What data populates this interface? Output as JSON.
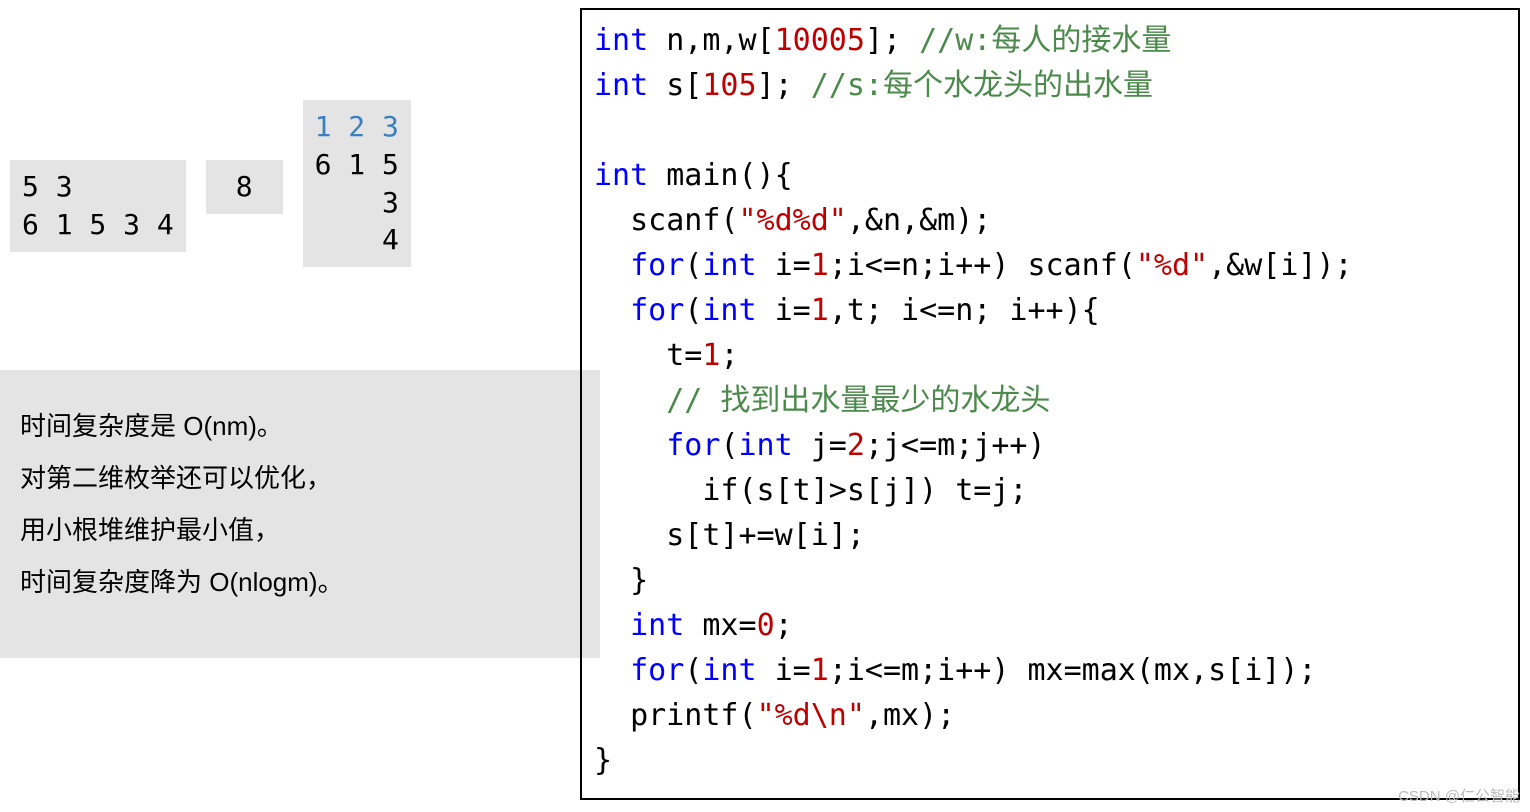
{
  "data_boxes": {
    "box1": {
      "line1": "5 3",
      "line2": "6 1 5 3 4"
    },
    "box2": {
      "value": "8"
    },
    "box3": {
      "header": "1 2 3",
      "rows": [
        "6 1 5",
        "    3",
        "    4"
      ]
    }
  },
  "notes": {
    "line1": "时间复杂度是 O(nm)。",
    "line2": "对第二维枚举还可以优化，",
    "line3": "用小根堆维护最小值，",
    "line4": "时间复杂度降为 O(nlogm)。"
  },
  "code": {
    "l1_a": "int",
    "l1_b": " n,m,w[",
    "l1_c": "10005",
    "l1_d": "]; ",
    "l1_e": "//w:每人的接水量",
    "l2_a": "int",
    "l2_b": " s[",
    "l2_c": "105",
    "l2_d": "]; ",
    "l2_e": "//s:每个水龙头的出水量",
    "l3": "",
    "l4_a": "int",
    "l4_b": " main(){",
    "l5_a": "  scanf(",
    "l5_b": "\"%d%d\"",
    "l5_c": ",&n,&m);",
    "l6_a": "  ",
    "l6_b": "for",
    "l6_c": "(",
    "l6_d": "int",
    "l6_e": " i=",
    "l6_f": "1",
    "l6_g": ";i<=n;i++) scanf(",
    "l6_h": "\"%d\"",
    "l6_i": ",&w[i]);",
    "l7_a": "  ",
    "l7_b": "for",
    "l7_c": "(",
    "l7_d": "int",
    "l7_e": " i=",
    "l7_f": "1",
    "l7_g": ",t; i<=n; i++){",
    "l8_a": "    t=",
    "l8_b": "1",
    "l8_c": ";",
    "l9_a": "    ",
    "l9_b": "// 找到出水量最少的水龙头",
    "l10_a": "    ",
    "l10_b": "for",
    "l10_c": "(",
    "l10_d": "int",
    "l10_e": " j=",
    "l10_f": "2",
    "l10_g": ";j<=m;j++)",
    "l11": "      if(s[t]>s[j]) t=j;",
    "l12": "    s[t]+=w[i];",
    "l13": "  }",
    "l14_a": "  ",
    "l14_b": "int",
    "l14_c": " mx=",
    "l14_d": "0",
    "l14_e": ";",
    "l15_a": "  ",
    "l15_b": "for",
    "l15_c": "(",
    "l15_d": "int",
    "l15_e": " i=",
    "l15_f": "1",
    "l15_g": ";i<=m;i++) mx=max(mx,s[i]);",
    "l16_a": "  printf(",
    "l16_b": "\"%d\\n\"",
    "l16_c": ",mx);",
    "l17": "}"
  },
  "watermark": "CSDN @仁公智能"
}
